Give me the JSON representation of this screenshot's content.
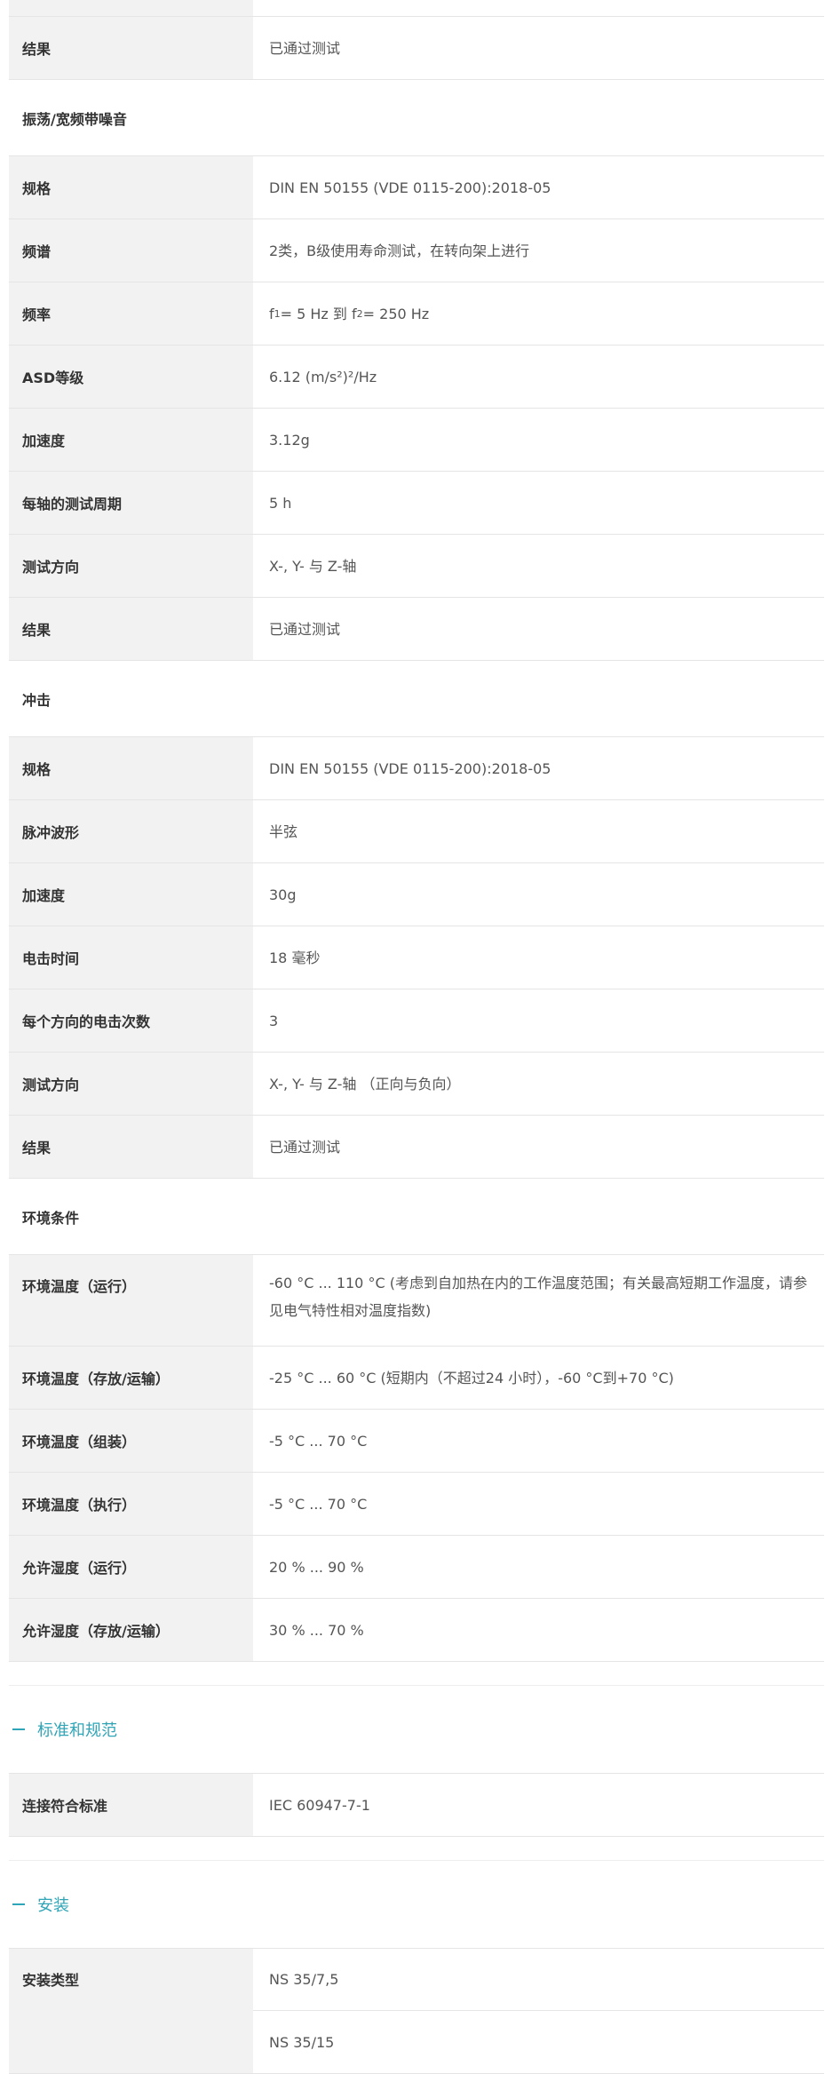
{
  "sections": {
    "test_result_top": {
      "label": "结果",
      "value": "已通过测试"
    },
    "vibration": {
      "title": "振荡/宽频带噪音",
      "rows": [
        {
          "label": "规格",
          "value": "DIN EN 50155 (VDE 0115-200):2018-05"
        },
        {
          "label": "频谱",
          "value": "2类，B级使用寿命测试，在转向架上进行"
        },
        {
          "label": "频率",
          "value_prefix": "f",
          "value_sub1": "1",
          "value_mid": " = 5 Hz 到 f",
          "value_sub2": "2",
          "value_suffix": " = 250 Hz"
        },
        {
          "label": "ASD等级",
          "value": "6.12 (m/s²)²/Hz"
        },
        {
          "label": "加速度",
          "value": "3.12g"
        },
        {
          "label": "每轴的测试周期",
          "value": "5 h"
        },
        {
          "label": "测试方向",
          "value": "X-, Y- 与 Z-轴"
        },
        {
          "label": "结果",
          "value": "已通过测试"
        }
      ]
    },
    "shock": {
      "title": "冲击",
      "rows": [
        {
          "label": "规格",
          "value": "DIN EN 50155 (VDE 0115-200):2018-05"
        },
        {
          "label": "脉冲波形",
          "value": "半弦"
        },
        {
          "label": "加速度",
          "value": "30g"
        },
        {
          "label": "电击时间",
          "value": "18 毫秒"
        },
        {
          "label": "每个方向的电击次数",
          "value": "3"
        },
        {
          "label": "测试方向",
          "value": "X-, Y- 与 Z-轴 （正向与负向）"
        },
        {
          "label": "结果",
          "value": "已通过测试"
        }
      ]
    },
    "environment": {
      "title": "环境条件",
      "rows": [
        {
          "label": "环境温度（运行）",
          "value": "-60 °C ... 110 °C (考虑到自加热在内的工作温度范围；有关最高短期工作温度，请参见电气特性相对温度指数)"
        },
        {
          "label": "环境温度（存放/运输）",
          "value": "-25 °C ... 60 °C (短期内（不超过24 小时），-60 °C到+70 °C)"
        },
        {
          "label": "环境温度（组装）",
          "value": "-5 °C ... 70 °C"
        },
        {
          "label": "环境温度（执行）",
          "value": "-5 °C ... 70 °C"
        },
        {
          "label": "允许湿度（运行）",
          "value": "20 % ... 90 %"
        },
        {
          "label": "允许湿度（存放/运输）",
          "value": "30 % ... 70 %"
        }
      ]
    },
    "standards": {
      "title": "标准和规范",
      "rows": [
        {
          "label": "连接符合标准",
          "value": "IEC 60947-7-1"
        }
      ]
    },
    "installation": {
      "title": "安装",
      "label": "安装类型",
      "values": [
        "NS 35/7,5",
        "NS 35/15"
      ]
    }
  },
  "colors": {
    "accent": "#30a5b7",
    "label_bg": "#f2f2f2",
    "border": "#e5e5e5"
  }
}
